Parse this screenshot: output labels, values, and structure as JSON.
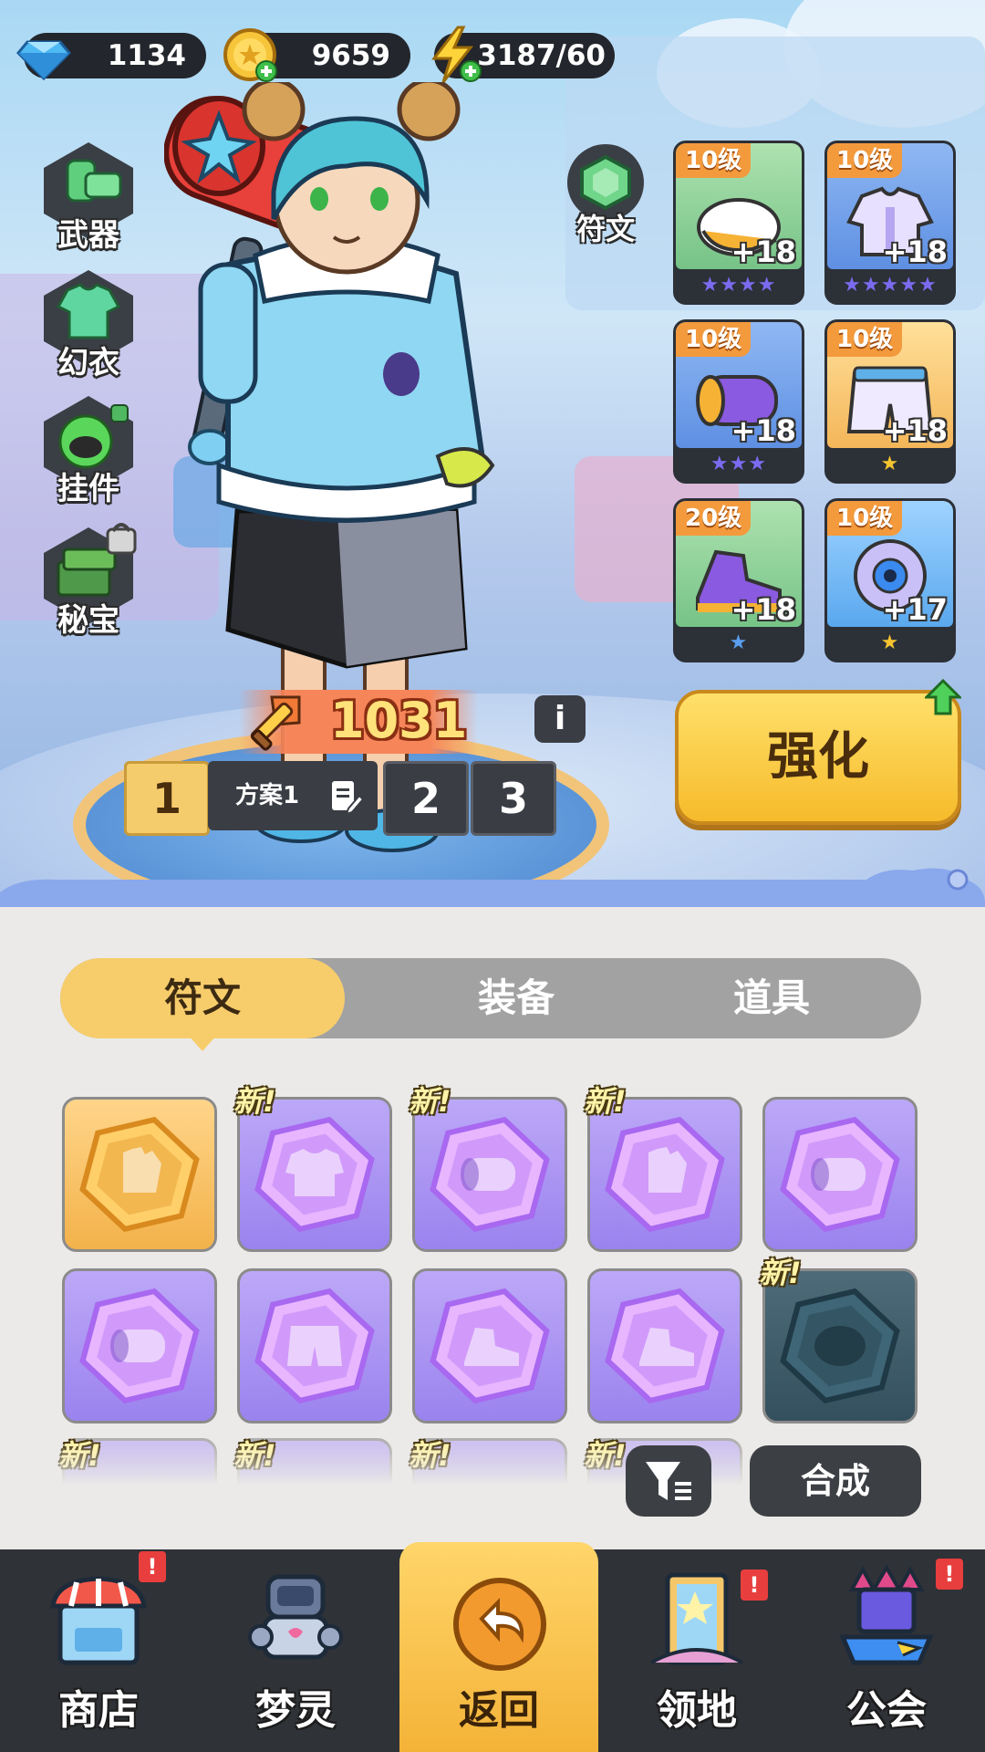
{
  "resources": [
    {
      "name": "gems",
      "icon": "diamond-icon",
      "value": "1134"
    },
    {
      "name": "coins",
      "icon": "coin-icon",
      "value": "9659"
    },
    {
      "name": "energy",
      "icon": "lightning-icon",
      "value": "3187/60"
    }
  ],
  "left_menu": [
    {
      "label": "武器",
      "icon": "weapon-icon"
    },
    {
      "label": "幻衣",
      "icon": "outfit-icon"
    },
    {
      "label": "挂件",
      "icon": "pendant-icon"
    },
    {
      "label": "秘宝",
      "icon": "treasure-icon",
      "locked": true
    }
  ],
  "rune_slot": {
    "label": "符文"
  },
  "equipment": [
    {
      "level": "10级",
      "plus": "+18",
      "stars": 4,
      "star_color": "#7a6cf0",
      "icon": "helmet-icon"
    },
    {
      "level": "10级",
      "plus": "+18",
      "stars": 5,
      "star_color": "#7a6cf0",
      "icon": "jacket-icon"
    },
    {
      "level": "10级",
      "plus": "+18",
      "stars": 3,
      "star_color": "#7a6cf0",
      "icon": "glove-icon"
    },
    {
      "level": "10级",
      "plus": "+18",
      "stars": 1,
      "star_color": "#f4c430",
      "icon": "shorts-icon"
    },
    {
      "level": "20级",
      "plus": "+18",
      "stars": 1,
      "star_color": "#5a9ef0",
      "icon": "shoe-icon"
    },
    {
      "level": "10级",
      "plus": "+17",
      "stars": 1,
      "star_color": "#f4c430",
      "icon": "eye-device-icon"
    }
  ],
  "power": {
    "value": "1031"
  },
  "info_button": {
    "label": "i"
  },
  "plans": {
    "active": "1",
    "active_name": "方案1",
    "others": [
      "2",
      "3"
    ]
  },
  "enhance_button": {
    "label": "强化"
  },
  "tabs": [
    {
      "label": "符文",
      "active": true
    },
    {
      "label": "装备",
      "active": false
    },
    {
      "label": "道具",
      "active": false
    }
  ],
  "runes": [
    {
      "color": "gold",
      "new": false,
      "icon": "glove-rune-icon"
    },
    {
      "color": "purple",
      "new": true,
      "icon": "jacket-rune-icon"
    },
    {
      "color": "purple",
      "new": true,
      "icon": "ring-rune-icon"
    },
    {
      "color": "purple",
      "new": true,
      "icon": "glove-rune-icon"
    },
    {
      "color": "purple",
      "new": false,
      "icon": "ring-rune-icon"
    },
    {
      "color": "purple",
      "new": false,
      "icon": "ring-rune-icon"
    },
    {
      "color": "purple",
      "new": false,
      "icon": "shorts-rune-icon"
    },
    {
      "color": "purple",
      "new": false,
      "icon": "shoe-rune-icon"
    },
    {
      "color": "purple",
      "new": false,
      "icon": "shoe-rune-icon"
    },
    {
      "color": "teal",
      "new": true,
      "icon": "helmet-rune-icon"
    }
  ],
  "new_label": "新!",
  "compose_button": {
    "label": "合成"
  },
  "bottom_nav": [
    {
      "label": "商店",
      "icon": "shop-icon",
      "badge": "!"
    },
    {
      "label": "梦灵",
      "icon": "robot-icon",
      "badge": ""
    },
    {
      "label": "返回",
      "icon": "back-arrow-icon",
      "badge": "",
      "active": true
    },
    {
      "label": "领地",
      "icon": "door-icon",
      "badge": "!"
    },
    {
      "label": "公会",
      "icon": "guild-icon",
      "badge": "!"
    }
  ]
}
